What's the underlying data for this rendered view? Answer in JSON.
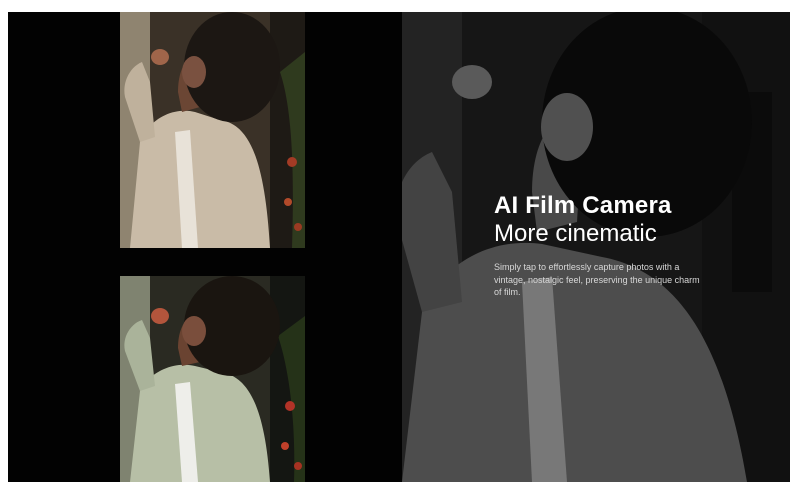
{
  "headline": {
    "title": "AI Film Camera",
    "subtitle": "More cinematic",
    "description": "Simply tap to effortlessly capture photos with a vintage, nostalgic feel, preserving the unique charm of film."
  },
  "colors": {
    "background": "#000000",
    "page": "#ffffff",
    "text": "#ffffff",
    "description_text": "#d8d8d8",
    "jacket_warm": "#c9bba7",
    "jacket_green": "#b7bfa6",
    "hair": "#1c1713"
  }
}
